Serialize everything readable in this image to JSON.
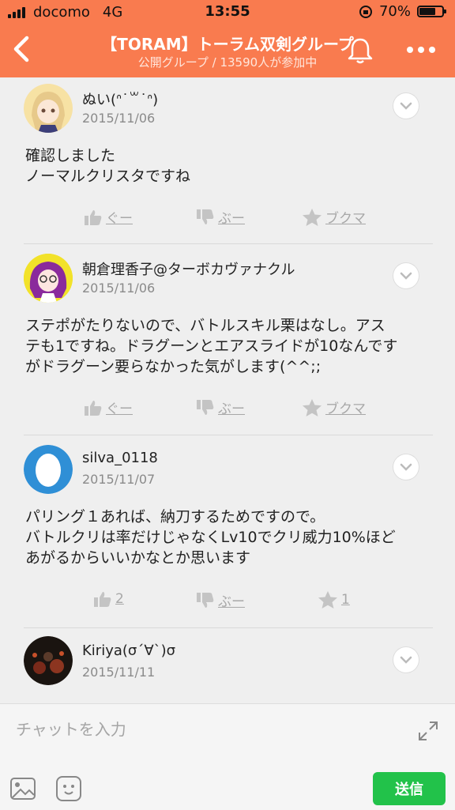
{
  "status": {
    "carrier": "docomo",
    "network": "4G",
    "time": "13:55",
    "battery": "70%",
    "battery_level": 0.7
  },
  "header": {
    "title": "【TORAM】トーラム双剣グループ",
    "subtitle": "公開グループ / 13590人が参加中"
  },
  "posts": [
    {
      "name": "ぬい(ᐢ˙꒳˙ᐢ)",
      "date": "2015/11/06",
      "lines": [
        "確認しました",
        "ノーマルクリスタですね"
      ],
      "good": "ぐー",
      "boo": "ぶー",
      "fav": "ブクマ"
    },
    {
      "name": "朝倉理香子@ターボカヴァナクル",
      "date": "2015/11/06",
      "lines": [
        "ステポがたりないので、バトルスキル栗はなし。アス",
        "テも1ですね。ドラグーンとエアスライドが10なんです",
        "がドラグーン要らなかった気がします(^^;;"
      ],
      "good": "ぐー",
      "boo": "ぶー",
      "fav": "ブクマ"
    },
    {
      "name": "silva_0118",
      "date": "2015/11/07",
      "lines": [
        "パリング１あれば、納刀するためですので。",
        "バトルクリは率だけじゃなくLv10でクリ威力10%ほど",
        "あがるからいいかなとか思います"
      ],
      "good": "2",
      "boo": "ぶー",
      "fav": "1"
    },
    {
      "name": "Kiriya(σ´∀`)σ",
      "date": "2015/11/11"
    }
  ],
  "input": {
    "placeholder": "チャットを入力",
    "send": "送信"
  },
  "colors": {
    "header": "#f97b4f",
    "send": "#22c24a"
  }
}
